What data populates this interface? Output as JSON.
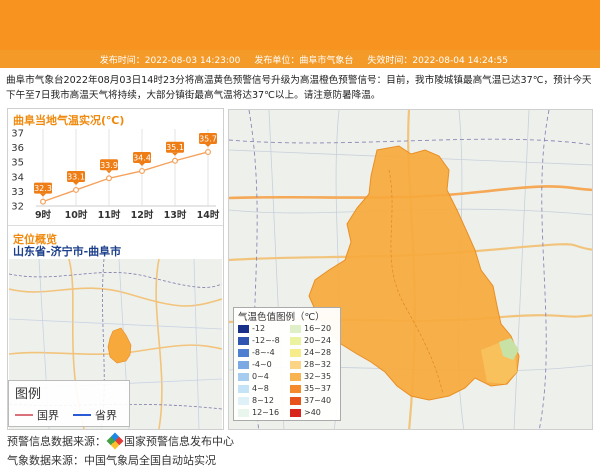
{
  "info_bar": {
    "publish_time": "发布时间：2022-08-03 14:23:00",
    "publisher": "发布单位：曲阜市气象台",
    "expire_time": "失效时间：2022-08-04 14:24:55"
  },
  "description": "曲阜市气象台2022年08月03日14时23分将高温黄色预警信号升级为高温橙色预警信号：目前，我市陵城镇最高气温已达37℃，预计今天下午至7日我市高温天气将持续，大部分镇街最高气温将达37℃以上。请注意防暑降温。",
  "temp_panel": {
    "title": "曲阜当地气温实况(℃)"
  },
  "chart_data": {
    "type": "line",
    "title": "曲阜当地气温实况(℃)",
    "categories": [
      "9时",
      "10时",
      "11时",
      "12时",
      "13时",
      "14时"
    ],
    "values": [
      32.3,
      33.1,
      33.9,
      34.4,
      35.1,
      35.7
    ],
    "yticks": [
      "32",
      "33",
      "34",
      "35",
      "36",
      "37"
    ],
    "ylim": [
      32,
      37
    ],
    "grid": true,
    "line_color": "#f5a25d",
    "label_color": "#ef7d16"
  },
  "location": {
    "title": "定位概览",
    "name": "山东省-济宁市-曲阜市"
  },
  "small_legend": {
    "title": "图例",
    "country_border": "国界",
    "province_border": "省界",
    "country_color": "#d9707a",
    "province_color": "#2a5bd7"
  },
  "temp_legend": {
    "title": "气温色值图例（℃）",
    "items": [
      {
        "label": "-12",
        "color": "#1a2f8a"
      },
      {
        "label": "16~20",
        "color": "#dff0c8"
      },
      {
        "label": "-12~-8",
        "color": "#2f55b0"
      },
      {
        "label": "20~24",
        "color": "#ecf3a0"
      },
      {
        "label": "-8~-4",
        "color": "#4f7fd0"
      },
      {
        "label": "24~28",
        "color": "#f7ec8a"
      },
      {
        "label": "-4~0",
        "color": "#7aa9e4"
      },
      {
        "label": "28~32",
        "color": "#fbd486"
      },
      {
        "label": "0~4",
        "color": "#a6cdf0"
      },
      {
        "label": "32~35",
        "color": "#f9b451"
      },
      {
        "label": "4~8",
        "color": "#c4e3f6"
      },
      {
        "label": "35~37",
        "color": "#f48a2c"
      },
      {
        "label": "8~12",
        "color": "#dff1f8"
      },
      {
        "label": "37~40",
        "color": "#e8531c"
      },
      {
        "label": "12~16",
        "color": "#e8f6ee"
      },
      {
        "label": ">40",
        "color": "#d9261c"
      }
    ]
  },
  "footer": {
    "warning_source_label": "预警信息数据来源：",
    "warning_source": "国家预警信息发布中心",
    "weather_source": "气象数据来源：中国气象局全国自动站实况"
  },
  "colors": {
    "header": "#f7931e",
    "accent": "#f08a0e",
    "region_fill": "#f7a93c"
  }
}
